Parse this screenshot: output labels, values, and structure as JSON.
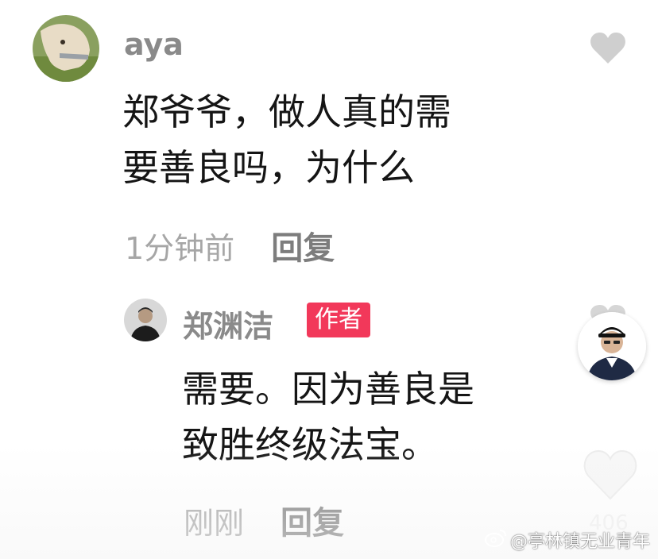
{
  "comment": {
    "username": "aya",
    "lines": [
      "郑爷爷，做人真的需",
      "要善良吗，为什么"
    ],
    "time": "1分钟前",
    "reply_label": "回复"
  },
  "reply": {
    "username": "郑渊洁",
    "badge": "作者",
    "lines": [
      "需要。因为善良是",
      "致胜终级法宝。"
    ],
    "time": "刚刚",
    "reply_label": "回复"
  },
  "sidebar": {
    "like_count": "406"
  },
  "watermark": {
    "text": "@亭林镇无业青年"
  },
  "colors": {
    "badge": "#f2385a",
    "username": "#8a8a8a",
    "time": "#a6a6a6",
    "reply": "#7d7d7d",
    "text": "#151515",
    "heart": "#cfcfcf"
  },
  "icons": {
    "comment_like": "heart-icon",
    "sidebar_like": "heart-icon",
    "watermark_logo": "weibo-logo-icon"
  }
}
